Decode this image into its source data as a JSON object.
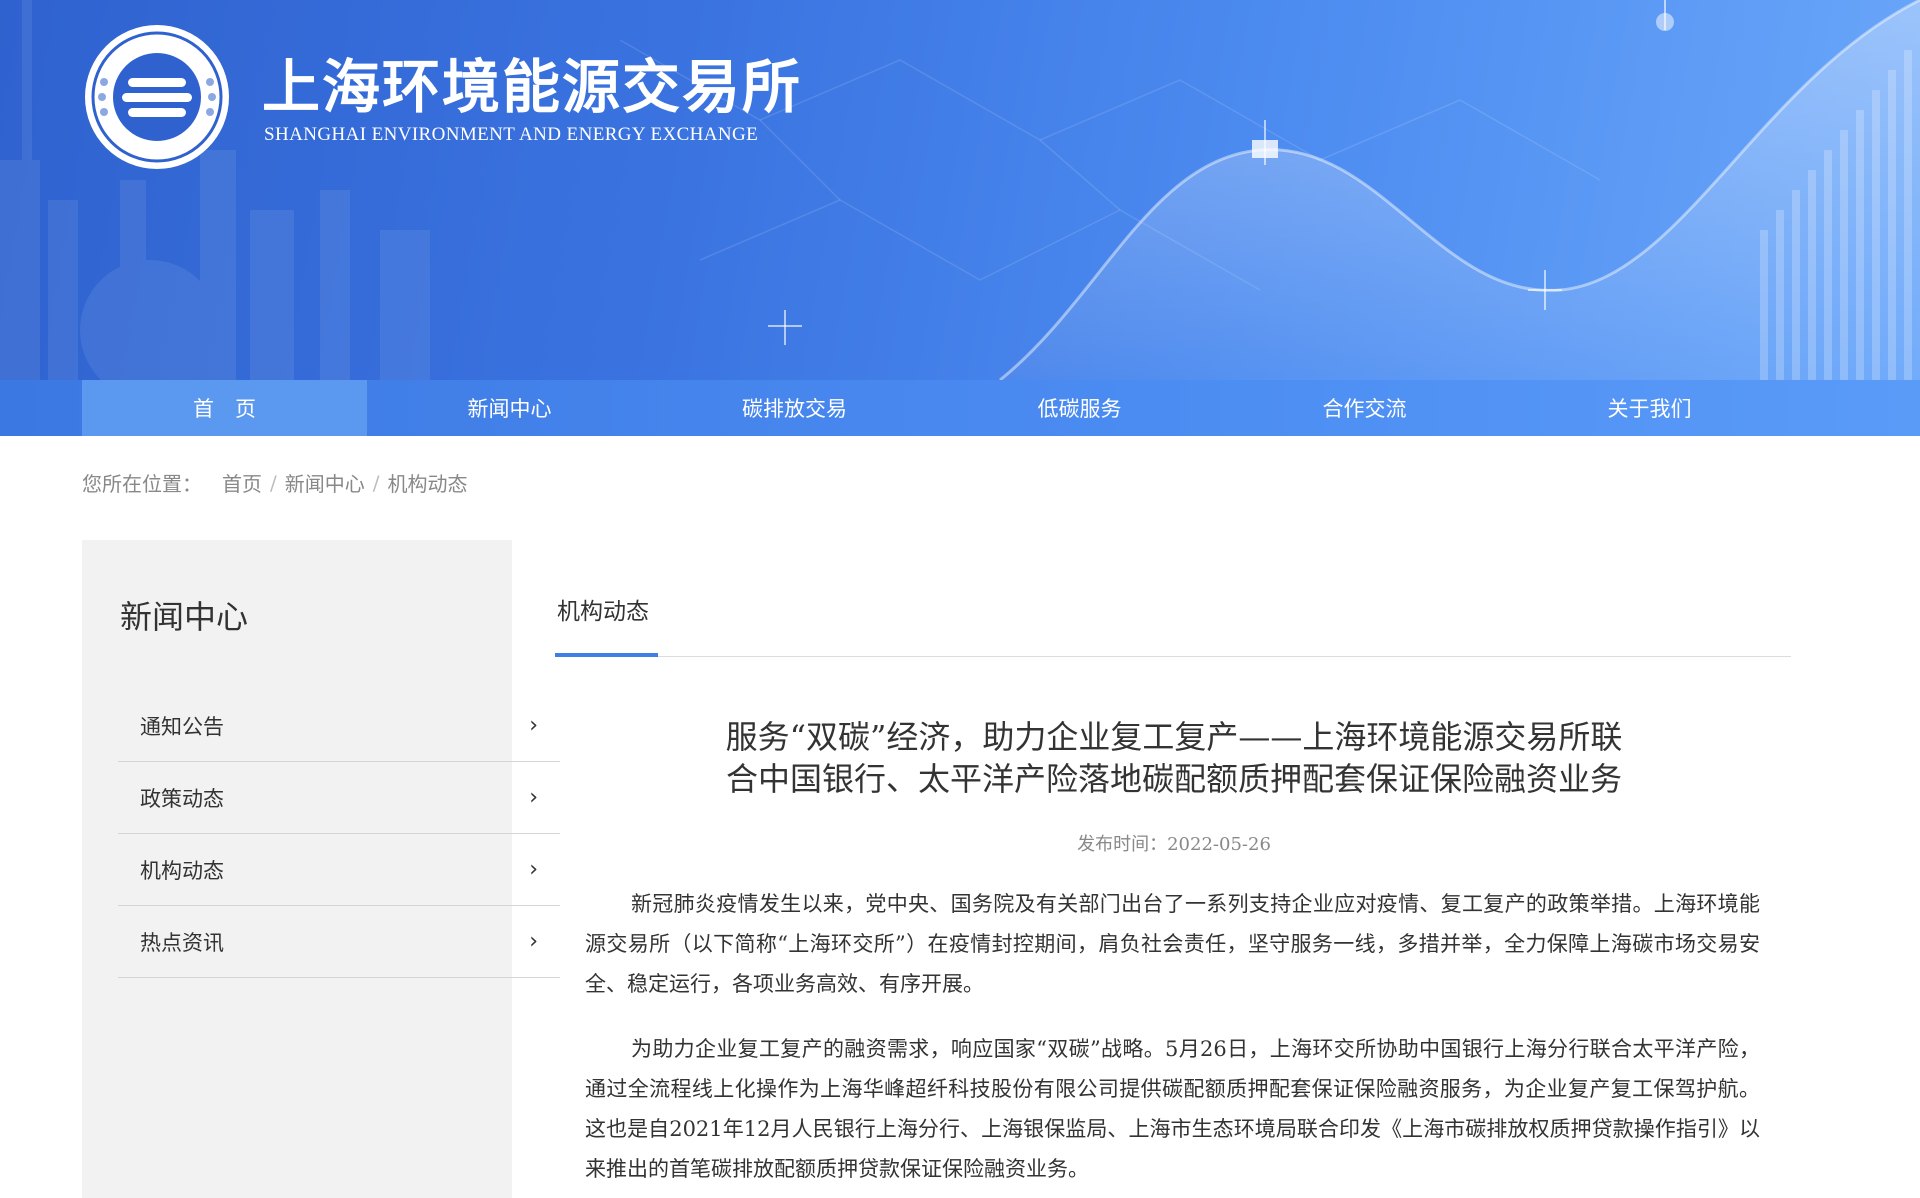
{
  "brand": {
    "name_cn": "上海环境能源交易所",
    "name_en": "SHANGHAI ENVIRONMENT AND ENERGY EXCHANGE",
    "primary_color": "#3a73e0",
    "accent_color": "#3f7ee6"
  },
  "nav": {
    "items": [
      {
        "label": "首　页",
        "active": true
      },
      {
        "label": "新闻中心",
        "active": false
      },
      {
        "label": "碳排放交易",
        "active": false
      },
      {
        "label": "低碳服务",
        "active": false
      },
      {
        "label": "合作交流",
        "active": false
      },
      {
        "label": "关于我们",
        "active": false
      }
    ]
  },
  "breadcrumb": {
    "prefix": "您所在位置：",
    "items": [
      "首页",
      "新闻中心",
      "机构动态"
    ],
    "separator": "/"
  },
  "sidebar": {
    "title": "新闻中心",
    "items": [
      {
        "label": "通知公告",
        "icon": "chevron-right-icon"
      },
      {
        "label": "政策动态",
        "icon": "chevron-right-icon"
      },
      {
        "label": "机构动态",
        "icon": "chevron-right-icon"
      },
      {
        "label": "热点资讯",
        "icon": "chevron-right-icon"
      }
    ]
  },
  "content": {
    "tab": "机构动态",
    "title": "服务“双碳”经济，助力企业复工复产——上海环境能源交易所联合中国银行、太平洋产险落地碳配额质押配套保证保险融资业务",
    "title_line1": "服务“双碳”经济，助力企业复工复产——上海环境能源交易所联",
    "title_line2": "合中国银行、太平洋产险落地碳配额质押配套保证保险融资业务",
    "date": "发布时间：2022-05-26",
    "paragraphs": [
      "新冠肺炎疫情发生以来，党中央、国务院及有关部门出台了一系列支持企业应对疫情、复工复产的政策举措。上海环境能源交易所（以下简称“上海环交所”）在疫情封控期间，肩负社会责任，坚守服务一线，多措并举，全力保障上海碳市场交易安全、稳定运行，各项业务高效、有序开展。",
      "为助力企业复工复产的融资需求，响应国家“双碳”战略。5月26日，上海环交所协助中国银行上海分行联合太平洋产险，通过全流程线上化操作为上海华峰超纤科技股份有限公司提供碳配额质押配套保证保险融资服务，为企业复产复工保驾护航。这也是自2021年12月人民银行上海分行、上海银保监局、上海市生态环境局联合印发《上海市碳排放权质押贷款操作指引》以来推出的首笔碳排放配额质押贷款保证保险融资业务。"
    ]
  }
}
